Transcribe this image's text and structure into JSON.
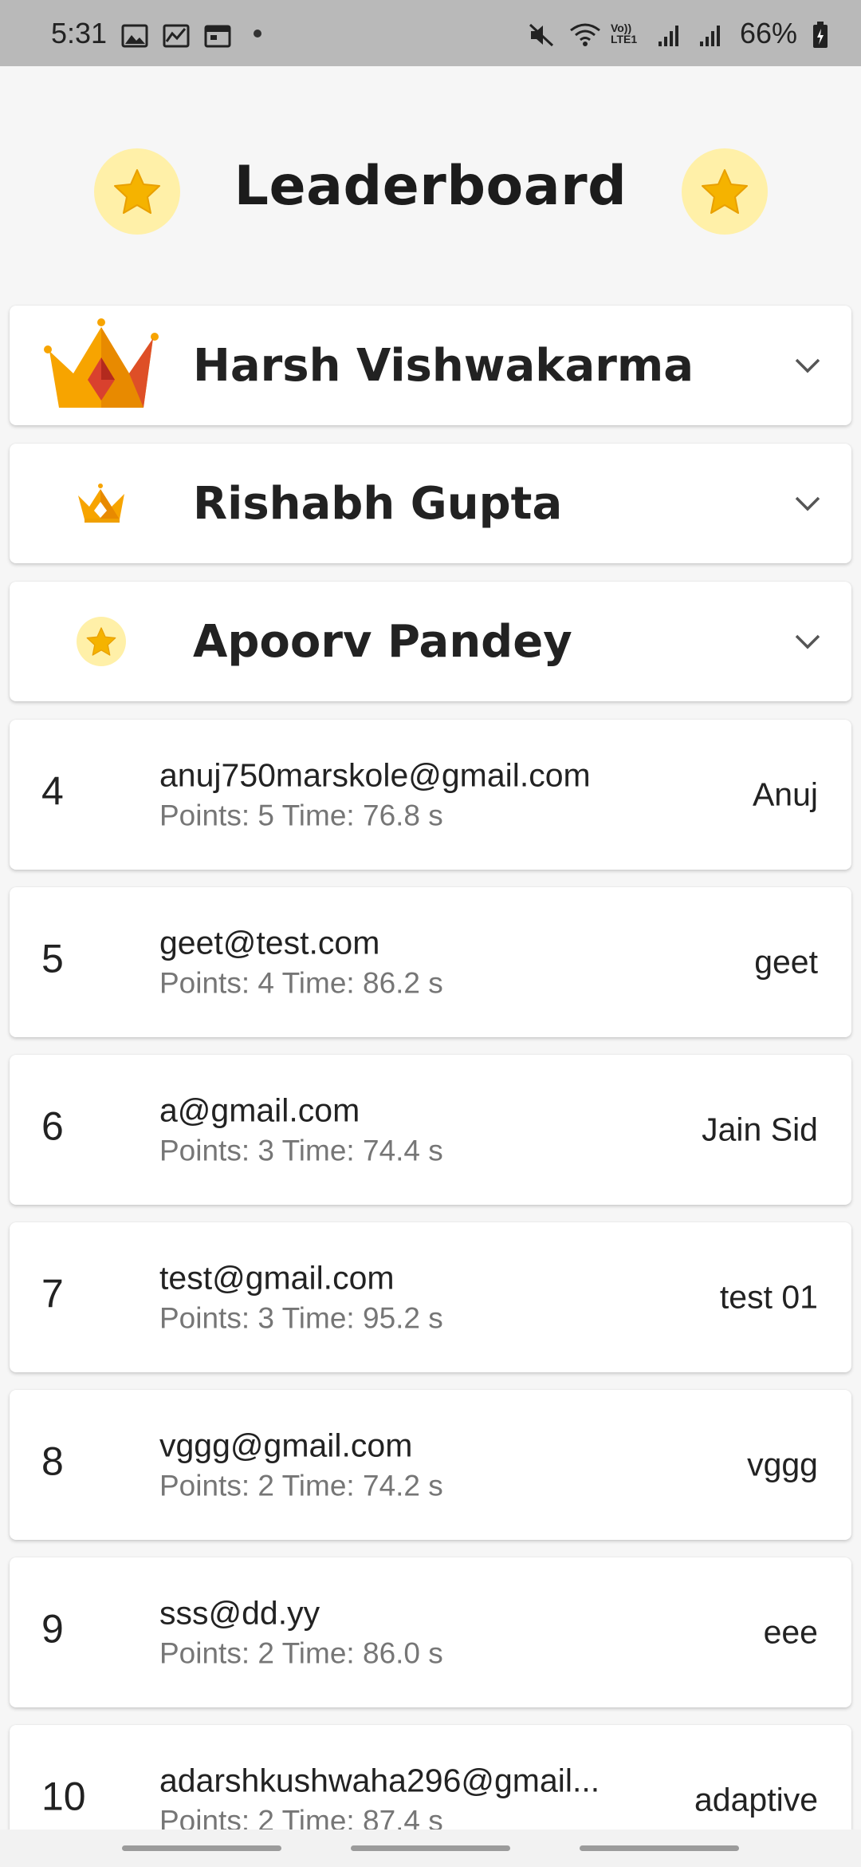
{
  "status_bar": {
    "time": "5:31",
    "battery": "66%",
    "left_icons": [
      "image-icon",
      "chart-icon",
      "calendar-icon",
      "dot-icon"
    ],
    "right_icons": [
      "mute-icon",
      "wifi-icon",
      "volte-icon",
      "signal-icon",
      "signal-icon",
      "battery-icon"
    ],
    "volte_label": "Vo)) LTE1"
  },
  "header": {
    "title": "Leaderboard"
  },
  "top_three": [
    {
      "name": "Harsh Vishwakarma",
      "icon": "large-crown-icon"
    },
    {
      "name": "Rishabh Gupta",
      "icon": "small-crown-icon"
    },
    {
      "name": "Apoorv Pandey",
      "icon": "star-badge-icon"
    }
  ],
  "entries": [
    {
      "rank": "4",
      "email": "anuj750marskole@gmail.com",
      "stats": "Points: 5 Time: 76.8 s",
      "name": "Anuj"
    },
    {
      "rank": "5",
      "email": "geet@test.com",
      "stats": "Points: 4 Time: 86.2 s",
      "name": "geet"
    },
    {
      "rank": "6",
      "email": "a@gmail.com",
      "stats": "Points: 3 Time: 74.4 s",
      "name": "Jain Sid"
    },
    {
      "rank": "7",
      "email": "test@gmail.com",
      "stats": "Points: 3 Time: 95.2 s",
      "name": "test 01"
    },
    {
      "rank": "8",
      "email": "vggg@gmail.com",
      "stats": "Points: 2 Time: 74.2 s",
      "name": "vggg"
    },
    {
      "rank": "9",
      "email": "sss@dd.yy",
      "stats": "Points: 2 Time: 86.0 s",
      "name": "eee"
    },
    {
      "rank": "10",
      "email": "adarshkushwaha296@gmail...",
      "stats": "Points: 2 Time: 87.4 s",
      "name": "adaptive"
    }
  ],
  "colors": {
    "star": "#f5b300",
    "star_badge_bg": "#fff0a8",
    "crown_gold": "#f7a400",
    "crown_red": "#d9412e"
  }
}
